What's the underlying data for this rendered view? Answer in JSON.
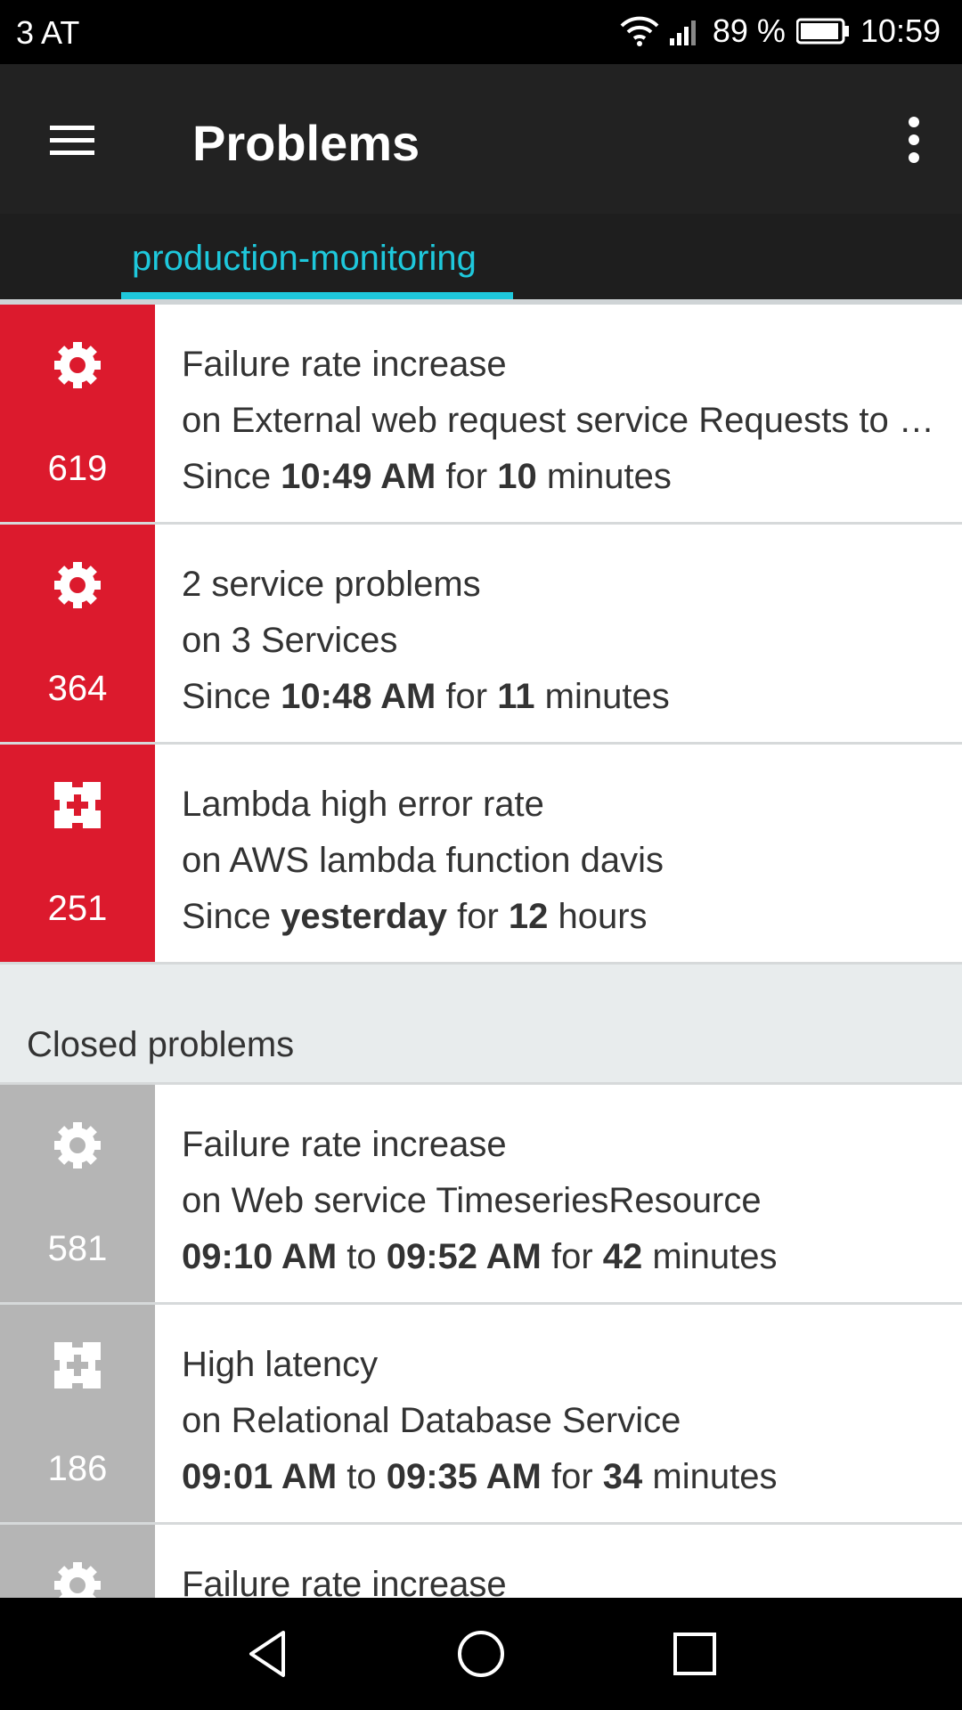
{
  "status_bar": {
    "carrier": "3 AT",
    "battery": "89 %",
    "time": "10:59"
  },
  "app_bar": {
    "title": "Problems"
  },
  "tabs": [
    {
      "label": "production-monitoring",
      "active": true
    }
  ],
  "colors": {
    "open": "#dc1a2d",
    "closed": "#b5b5b5",
    "accent": "#1ec8dc",
    "appbar": "#222222"
  },
  "open_problems": [
    {
      "icon": "gear-icon",
      "count": "619",
      "title": "Failure rate increase",
      "subtitle": "on External web request service Requests to public networks",
      "time": {
        "prefix": "Since ",
        "start": "10:49 AM",
        "mid": " for ",
        "duration": "10",
        "unit": " minutes"
      }
    },
    {
      "icon": "gear-icon",
      "count": "364",
      "title": "2 service problems",
      "subtitle": "on 3 Services",
      "time": {
        "prefix": "Since ",
        "start": "10:48 AM",
        "mid": " for ",
        "duration": "11",
        "unit": " minutes"
      }
    },
    {
      "icon": "plugin-icon",
      "count": "251",
      "title": "Lambda high error rate",
      "subtitle": "on AWS lambda function davis",
      "time": {
        "prefix": "Since ",
        "start": "yesterday",
        "mid": " for ",
        "duration": "12",
        "unit": " hours"
      }
    }
  ],
  "closed_section": {
    "title": "Closed problems"
  },
  "closed_problems": [
    {
      "icon": "gear-icon",
      "count": "581",
      "title": "Failure rate increase",
      "subtitle": "on Web service TimeseriesResource",
      "time": {
        "start": "09:10 AM",
        "to": " to ",
        "end": "09:52 AM",
        "mid": " for ",
        "duration": "42",
        "unit": " minutes"
      }
    },
    {
      "icon": "plugin-icon",
      "count": "186",
      "title": "High latency",
      "subtitle": "on Relational Database Service",
      "time": {
        "start": "09:01 AM",
        "to": " to ",
        "end": "09:35 AM",
        "mid": " for ",
        "duration": "34",
        "unit": " minutes"
      }
    },
    {
      "icon": "gear-icon",
      "count": "",
      "title": "Failure rate increase",
      "subtitle": "",
      "time": {
        "start": "",
        "to": "",
        "end": "",
        "mid": "",
        "duration": "",
        "unit": ""
      }
    }
  ]
}
